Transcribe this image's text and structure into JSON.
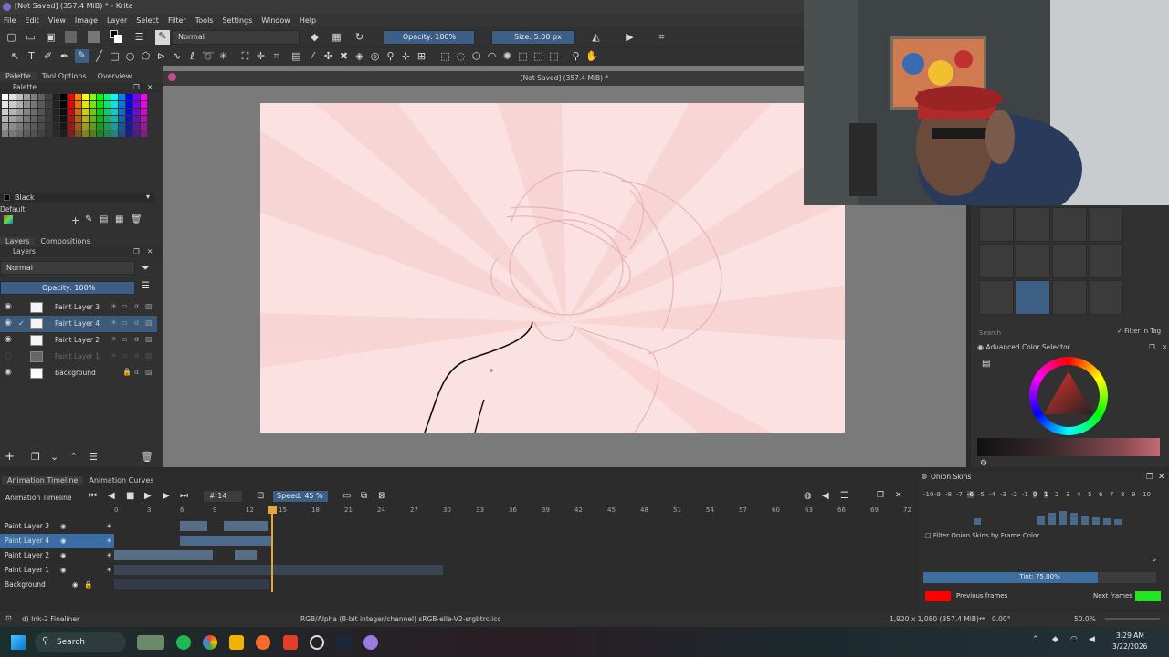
{
  "window": {
    "title": "[Not Saved]  (357.4 MiB) * - Krita"
  },
  "menu": [
    "File",
    "Edit",
    "View",
    "Image",
    "Layer",
    "Select",
    "Filter",
    "Tools",
    "Settings",
    "Window",
    "Help"
  ],
  "toolbar": {
    "blend_mode": "Normal",
    "opacity": "Opacity: 100%",
    "size": "Size: 5.00 px"
  },
  "left_tabs": [
    "Palette",
    "Tool Options",
    "Overview"
  ],
  "palette": {
    "title": "Palette",
    "current_color": "Black",
    "preset": "Default"
  },
  "layers_tabs": [
    "Layers",
    "Compositions"
  ],
  "layers": {
    "title": "Layers",
    "blend": "Normal",
    "opacity": "Opacity:  100%",
    "items": [
      {
        "name": "Paint Layer 3"
      },
      {
        "name": "Paint Layer 4"
      },
      {
        "name": "Paint Layer 2"
      },
      {
        "name": "Paint Layer 1"
      },
      {
        "name": "Background"
      }
    ]
  },
  "canvas": {
    "tab_title": "[Not Saved]  (357.4 MiB) *"
  },
  "brushes": {
    "search_placeholder": "Search",
    "filter_label": "Filter in Tag"
  },
  "color_selector": {
    "title": "Advanced Color Selector"
  },
  "timeline": {
    "tabs": [
      "Animation Timeline",
      "Animation Curves"
    ],
    "title": "Animation Timeline",
    "frame": "14",
    "speed": "Speed: 45 %",
    "ruler": [
      "0",
      "3",
      "6",
      "9",
      "12",
      "15",
      "18",
      "21",
      "24",
      "27",
      "30",
      "33",
      "36",
      "39",
      "42",
      "45",
      "48",
      "51",
      "54",
      "57",
      "60",
      "63",
      "66",
      "69",
      "72"
    ],
    "layers": [
      "Paint Layer 3",
      "Paint Layer 4",
      "Paint Layer 2",
      "Paint Layer 1",
      "Background"
    ]
  },
  "onion": {
    "title": "Onion Skins",
    "numbers": [
      "-10",
      "-9",
      "-8",
      "-7",
      "-6",
      "-5",
      "-4",
      "-3",
      "-2",
      "-1",
      "0",
      "1",
      "2",
      "3",
      "4",
      "5",
      "6",
      "7",
      "8",
      "9",
      "10"
    ],
    "filter": "Filter Onion Skins by Frame Color",
    "tint": "Tint: 75.00%",
    "tint_value": 0.75,
    "prev": "Previous frames",
    "next": "Next frames",
    "prev_color": "#ff0000",
    "next_color": "#22e622"
  },
  "status": {
    "brush": "d) Ink-2 Fineliner",
    "colorspace": "RGB/Alpha (8-bit integer/channel)  sRGB-elle-V2-srgbtrc.icc",
    "dimensions": "1,920 x 1,080 (357.4 MiB)",
    "rotation": "0.00°",
    "zoom": "50.0%"
  },
  "taskbar": {
    "search": "Search",
    "time": "3:29 AM",
    "date": "3/22/2026"
  },
  "colors": {
    "accent": "#3d5f86",
    "canvas_bg": "#fbe1e1",
    "selection": "#3b6ea5",
    "playhead": "#e8a33a"
  }
}
